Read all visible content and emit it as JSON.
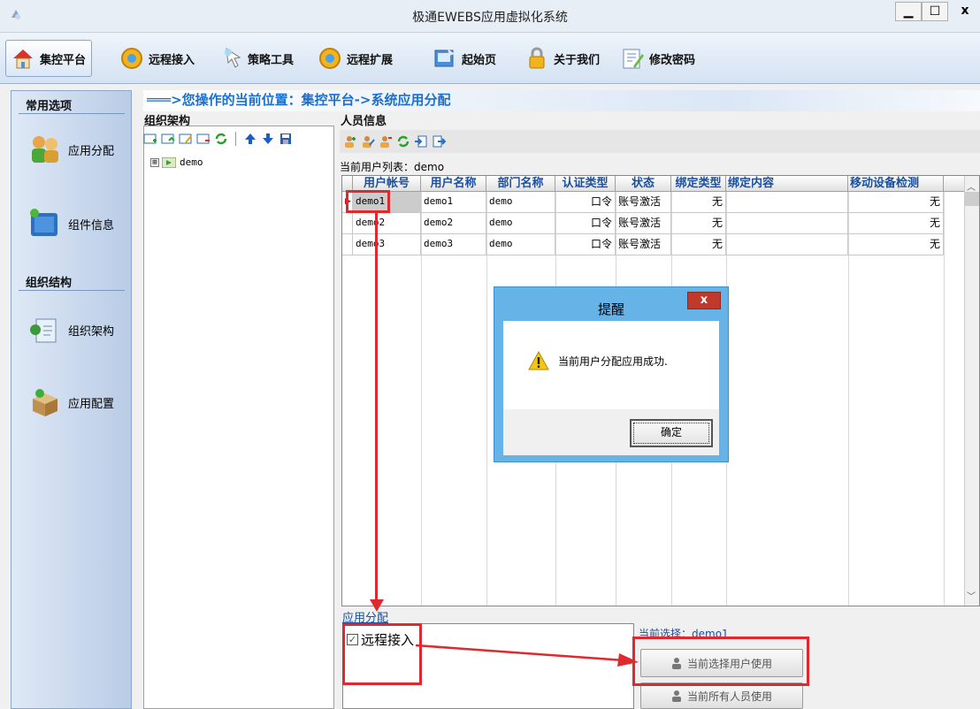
{
  "window": {
    "title": "极通EWEBS应用虚拟化系统",
    "controls": {
      "minimize": "▁",
      "maximize": "☐",
      "close": "x"
    }
  },
  "toolbar": {
    "items": [
      {
        "label": "集控平台",
        "icon": "home-icon",
        "active": true
      },
      {
        "label": "远程接入",
        "icon": "gear-icon"
      },
      {
        "label": "策略工具",
        "icon": "pointer-icon"
      },
      {
        "label": "远程扩展",
        "icon": "gear-icon"
      },
      {
        "label": "起始页",
        "icon": "start-page-icon"
      },
      {
        "label": "关于我们",
        "icon": "lock-icon"
      },
      {
        "label": "修改密码",
        "icon": "edit-password-icon"
      }
    ]
  },
  "sidebar": {
    "section1": "常用选项",
    "items1": [
      {
        "label": "应用分配",
        "icon": "users-icon"
      },
      {
        "label": "组件信息",
        "icon": "folder-icon"
      }
    ],
    "section2": "组织结构",
    "items2": [
      {
        "label": "组织架构",
        "icon": "org-icon"
      },
      {
        "label": "应用配置",
        "icon": "box-icon"
      }
    ]
  },
  "breadcrumb": "═══>您操作的当前位置：集控平台->系统应用分配",
  "org": {
    "title": "组织架构",
    "tree_root": "demo",
    "tree_expander": "⊞"
  },
  "people": {
    "title": "人员信息",
    "list_caption": "当前用户列表：demo"
  },
  "grid": {
    "columns": [
      "用户帐号",
      "用户名称",
      "部门名称",
      "认证类型",
      "状态",
      "绑定类型",
      "绑定内容",
      "移动设备检测"
    ],
    "rows": [
      {
        "account": "demo1",
        "name": "demo1",
        "dept": "demo",
        "auth": "口令",
        "status": "账号激活",
        "bind_type": "无",
        "bind_content": "",
        "mobile": "无"
      },
      {
        "account": "demo2",
        "name": "demo2",
        "dept": "demo",
        "auth": "口令",
        "status": "账号激活",
        "bind_type": "无",
        "bind_content": "",
        "mobile": "无"
      },
      {
        "account": "demo3",
        "name": "demo3",
        "dept": "demo",
        "auth": "口令",
        "status": "账号激活",
        "bind_type": "无",
        "bind_content": "",
        "mobile": "无"
      }
    ]
  },
  "assign": {
    "title": "应用分配",
    "checkbox_label": "远程接入",
    "checked": true,
    "current_selection": "当前选择：demo1",
    "btn_current_user": "当前选择用户使用",
    "btn_all_users": "当前所有人员使用"
  },
  "dialog": {
    "title": "提醒",
    "close": "x",
    "message": "当前用户分配应用成功.",
    "ok": "确定"
  },
  "colors": {
    "accent": "#1a6fd1",
    "highlight_red": "#e0292f",
    "dialog_frame": "#66b3e8"
  }
}
